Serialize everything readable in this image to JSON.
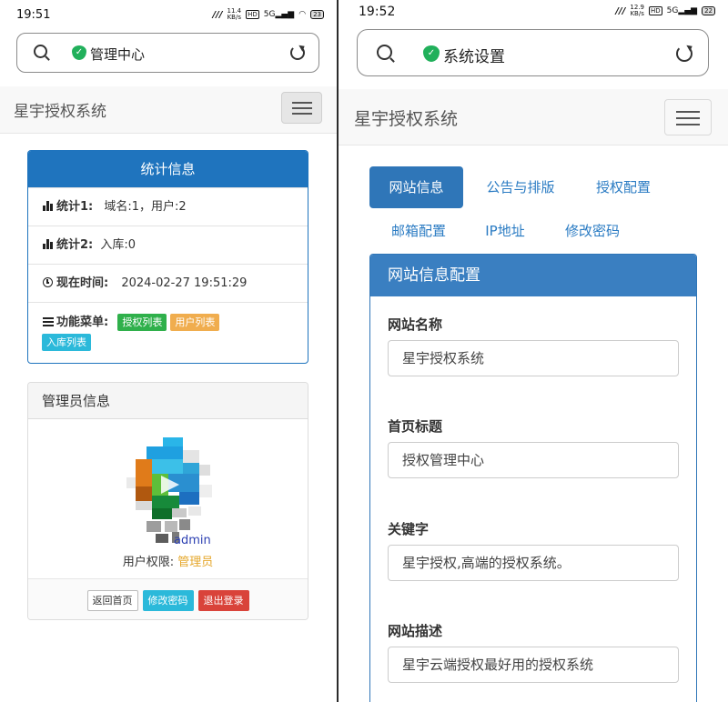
{
  "left": {
    "status": {
      "time": "19:51",
      "speed_value": "11.4",
      "speed_unit": "KB/s",
      "network": "5G",
      "battery": "23"
    },
    "address": {
      "text": "管理中心"
    },
    "brand": "星宇授权系统",
    "stats_panel": {
      "title": "统计信息",
      "row1_label": "统计1:",
      "row1_value": "域名:1，用户:2",
      "row2_label": "统计2:",
      "row2_value": "入库:0",
      "row3_label": "现在时间:",
      "row3_value": "2024-02-27 19:51:29",
      "row4_label": "功能菜单:",
      "menu": [
        "授权列表",
        "用户列表",
        "入库列表"
      ]
    },
    "admin_panel": {
      "title": "管理员信息",
      "username": "admin",
      "perm_label": "用户权限:",
      "perm_value": "管理员",
      "buttons": [
        "返回首页",
        "修改密码",
        "退出登录"
      ]
    }
  },
  "right": {
    "status": {
      "time": "19:52",
      "speed_value": "12.9",
      "speed_unit": "KB/s",
      "network": "5G",
      "battery": "22"
    },
    "address": {
      "text": "系统设置"
    },
    "brand": "星宇授权系统",
    "tabs": [
      "网站信息",
      "公告与排版",
      "授权配置",
      "邮箱配置",
      "IP地址",
      "修改密码"
    ],
    "config_panel": {
      "title": "网站信息配置",
      "fields": [
        {
          "label": "网站名称",
          "value": "星宇授权系统"
        },
        {
          "label": "首页标题",
          "value": "授权管理中心"
        },
        {
          "label": "关键字",
          "value": "星宇授权,高端的授权系统。"
        },
        {
          "label": "网站描述",
          "value": "星宇云端授权最好用的授权系统"
        }
      ]
    }
  },
  "colors": {
    "primary": "#1f74be",
    "shield": "#21b05b",
    "label_green": "#2fb04b",
    "label_orange": "#f0ad4e",
    "label_cyan": "#2bb9da",
    "danger": "#d9433a",
    "perm": "#e5a72b"
  }
}
